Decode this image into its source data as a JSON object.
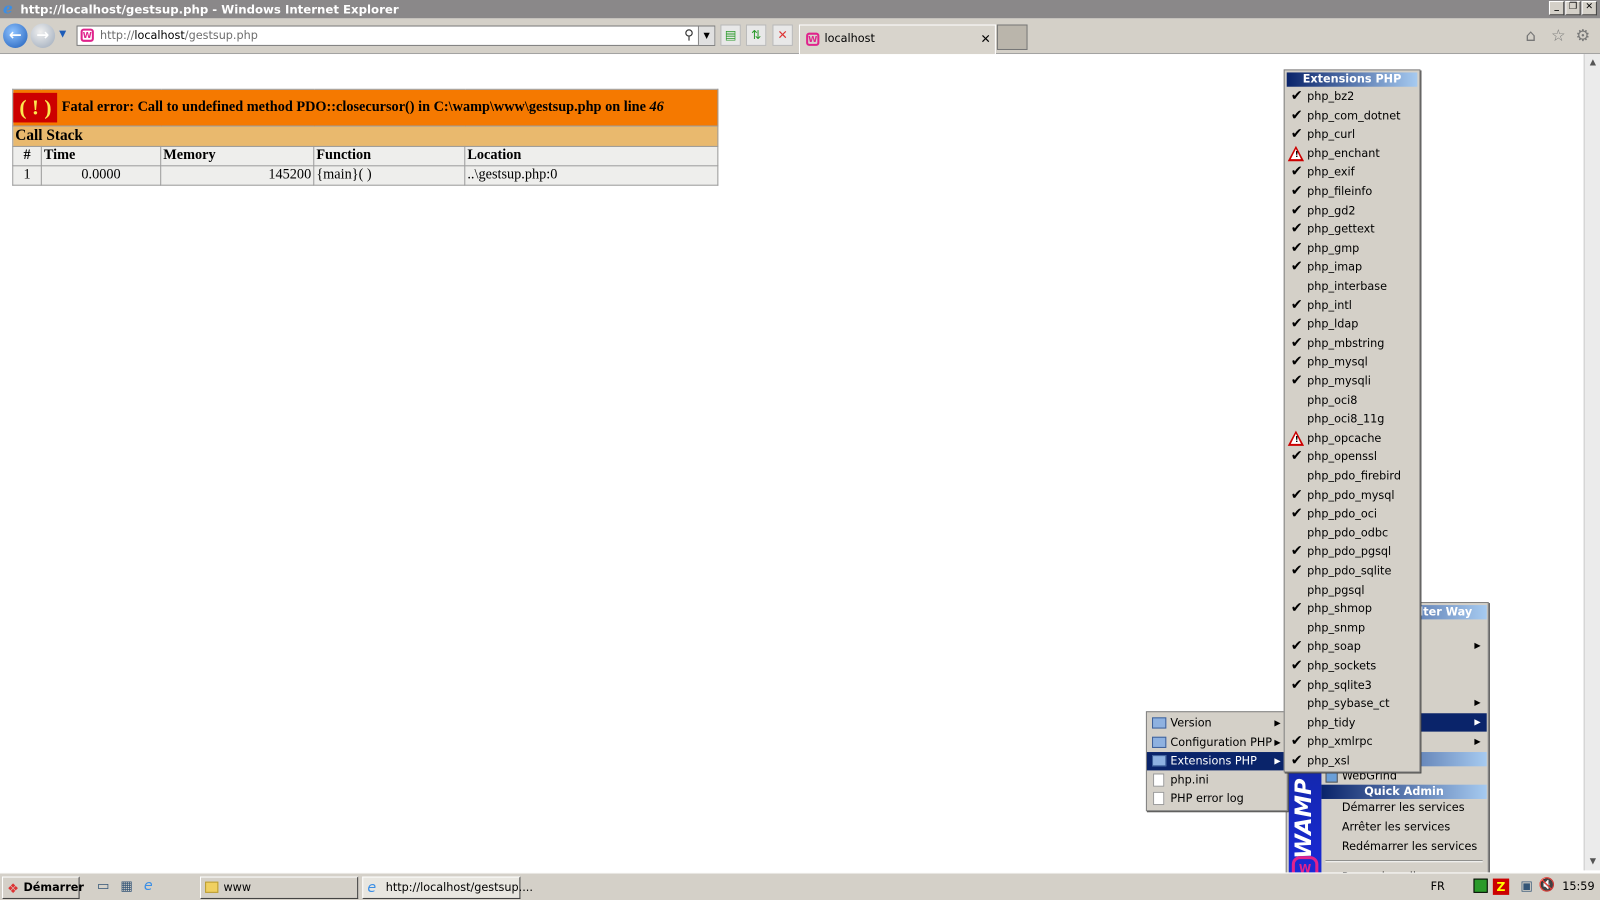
{
  "window": {
    "title": "http://localhost/gestsup.php - Windows Internet Explorer"
  },
  "browser": {
    "address_prefix": "http://",
    "address_host": "localhost",
    "address_path": "/gestsup.php",
    "tab_label": "localhost"
  },
  "error": {
    "icon_text": "( ! )",
    "message": "Fatal error: Call to undefined method PDO::closecursor() in C:\\wamp\\www\\gestsup.php on line ",
    "line": "46",
    "call_stack_label": "Call Stack",
    "columns": [
      "#",
      "Time",
      "Memory",
      "Function",
      "Location"
    ],
    "rows": [
      {
        "num": "1",
        "time": "0.0000",
        "memory": "145200",
        "function": "{main}( )",
        "location": "..\\gestsup.php:0"
      }
    ]
  },
  "ext_menu": {
    "header": "Extensions PHP",
    "items": [
      {
        "label": "php_bz2",
        "state": "checked"
      },
      {
        "label": "php_com_dotnet",
        "state": "checked"
      },
      {
        "label": "php_curl",
        "state": "checked"
      },
      {
        "label": "php_enchant",
        "state": "warning"
      },
      {
        "label": "php_exif",
        "state": "checked"
      },
      {
        "label": "php_fileinfo",
        "state": "checked"
      },
      {
        "label": "php_gd2",
        "state": "checked"
      },
      {
        "label": "php_gettext",
        "state": "checked"
      },
      {
        "label": "php_gmp",
        "state": "checked"
      },
      {
        "label": "php_imap",
        "state": "checked"
      },
      {
        "label": "php_interbase",
        "state": "none"
      },
      {
        "label": "php_intl",
        "state": "checked"
      },
      {
        "label": "php_ldap",
        "state": "checked"
      },
      {
        "label": "php_mbstring",
        "state": "checked"
      },
      {
        "label": "php_mysql",
        "state": "checked"
      },
      {
        "label": "php_mysqli",
        "state": "checked"
      },
      {
        "label": "php_oci8",
        "state": "none"
      },
      {
        "label": "php_oci8_11g",
        "state": "none"
      },
      {
        "label": "php_opcache",
        "state": "warning"
      },
      {
        "label": "php_openssl",
        "state": "checked"
      },
      {
        "label": "php_pdo_firebird",
        "state": "none"
      },
      {
        "label": "php_pdo_mysql",
        "state": "checked"
      },
      {
        "label": "php_pdo_oci",
        "state": "checked"
      },
      {
        "label": "php_pdo_odbc",
        "state": "none"
      },
      {
        "label": "php_pdo_pgsql",
        "state": "checked"
      },
      {
        "label": "php_pdo_sqlite",
        "state": "checked"
      },
      {
        "label": "php_pgsql",
        "state": "none"
      },
      {
        "label": "php_shmop",
        "state": "checked"
      },
      {
        "label": "php_snmp",
        "state": "none"
      },
      {
        "label": "php_soap",
        "state": "checked"
      },
      {
        "label": "php_sockets",
        "state": "checked"
      },
      {
        "label": "php_sqlite3",
        "state": "checked"
      },
      {
        "label": "php_sybase_ct",
        "state": "none"
      },
      {
        "label": "php_tidy",
        "state": "none"
      },
      {
        "label": "php_xmlrpc",
        "state": "checked"
      },
      {
        "label": "php_xsl",
        "state": "checked"
      }
    ]
  },
  "php_menu": {
    "items": [
      {
        "label": "Version",
        "icon": "folder-icon",
        "submenu": true
      },
      {
        "label": "Configuration PHP",
        "icon": "folder-icon",
        "submenu": true
      },
      {
        "label": "Extensions PHP",
        "icon": "folder-icon",
        "submenu": true,
        "selected": true
      },
      {
        "label": "php.ini",
        "icon": "document-icon"
      },
      {
        "label": "PHP error log",
        "icon": "document-icon"
      }
    ]
  },
  "wamp_menu": {
    "header_partial": "lter Way",
    "sidebar_text": "WAMP",
    "webgrind": "WebGrind",
    "quick_admin": "Quick Admin",
    "actions": [
      "Démarrer les services",
      "Arrêter les services",
      "Redémarrer les services"
    ],
    "offline": "Passer hors ligne"
  },
  "taskbar": {
    "start": "Démarrer",
    "tasks": [
      "www",
      "http://localhost/gestsup...."
    ],
    "lang": "FR",
    "clock": "15:59"
  }
}
